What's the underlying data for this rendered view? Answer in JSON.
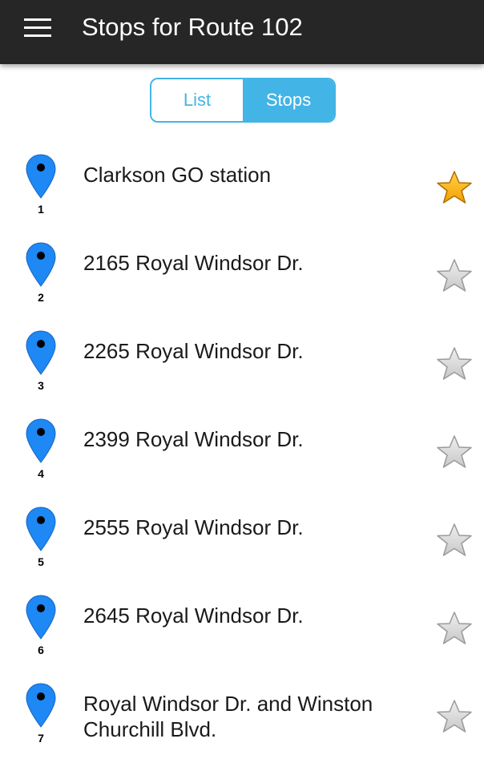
{
  "header": {
    "title": "Stops for Route 102",
    "menu_icon": "hamburger-menu-icon"
  },
  "view_toggle": {
    "options": [
      {
        "label": "List",
        "selected": false
      },
      {
        "label": "Stops",
        "selected": true
      }
    ],
    "accent_color": "#43b4e6"
  },
  "stops": [
    {
      "number": "1",
      "name": "Clarkson GO station",
      "favorite": true
    },
    {
      "number": "2",
      "name": "2165 Royal Windsor Dr.",
      "favorite": false
    },
    {
      "number": "3",
      "name": "2265 Royal Windsor Dr.",
      "favorite": false
    },
    {
      "number": "4",
      "name": "2399 Royal Windsor Dr.",
      "favorite": false
    },
    {
      "number": "5",
      "name": "2555 Royal Windsor Dr.",
      "favorite": false
    },
    {
      "number": "6",
      "name": "2645 Royal Windsor Dr.",
      "favorite": false
    },
    {
      "number": "7",
      "name": "Royal Windsor Dr. and Winston Churchill Blvd.",
      "favorite": false
    }
  ],
  "colors": {
    "app_bar": "#262626",
    "pin": "#1e88f5",
    "star_favorite": "#f5a000",
    "star_default": "#c8c8c8"
  }
}
